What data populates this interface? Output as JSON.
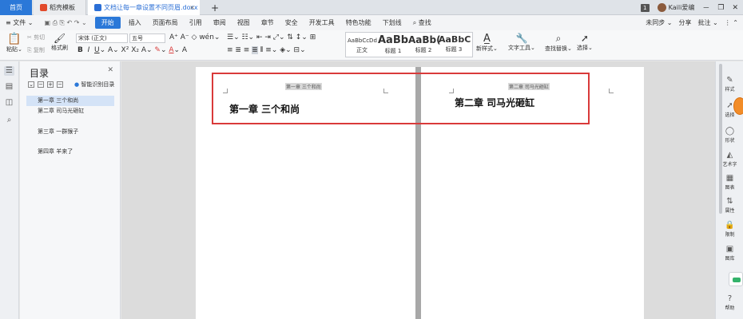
{
  "tabs": {
    "home": "首页",
    "template": "稻壳模板",
    "doc": "文档让每一章设置不同页眉.docx",
    "add": "+"
  },
  "titlebar_right": {
    "badge": "1",
    "user": "Kaili爱编",
    "min": "－",
    "restore": "❐",
    "close": "✕"
  },
  "menu": {
    "file": "≡ 文件 ⌄",
    "items": [
      "开始",
      "插入",
      "页面布局",
      "引用",
      "审阅",
      "视图",
      "章节",
      "安全",
      "开发工具",
      "特色功能",
      "下划线"
    ],
    "search": "查找",
    "right": [
      "未同步 ⌄",
      "分享",
      "批注 ⌄"
    ]
  },
  "ribbon": {
    "paste": "粘贴⌄",
    "cut": "剪切",
    "copy": "复制",
    "format_painter": "格式刷",
    "font": "宋体 (正文)",
    "size": "五号",
    "styles": [
      {
        "sample": "AaBbCcDd",
        "label": "正文"
      },
      {
        "sample": "AaBb",
        "label": "标题 1"
      },
      {
        "sample": "AaBb(",
        "label": "标题 2"
      },
      {
        "sample": "AaBbC",
        "label": "标题 3"
      }
    ],
    "new_style": "新样式⌄",
    "text_tools": "文字工具⌄",
    "find_replace": "查找替换⌄",
    "select": "选择⌄"
  },
  "toc": {
    "title": "目录",
    "smart": "智能识别目录",
    "items": [
      "第一章  三个和尚",
      "第二章  司马光砸缸",
      "第三章  一群猴子",
      "第四章  羊来了"
    ]
  },
  "doc": {
    "header_left": "第一章  三个和尚",
    "header_right": "第二章  司马光砸缸",
    "chapter_left": "第一章  三个和尚",
    "chapter_right": "第二章  司马光砸缸"
  },
  "right_panel": [
    "样式",
    "选择",
    "形状",
    "艺术字",
    "图表",
    "属性",
    "限制",
    "图库",
    "帮助"
  ],
  "colors": {
    "accent": "#2b78d8",
    "highlight_box": "#d93a3a"
  }
}
